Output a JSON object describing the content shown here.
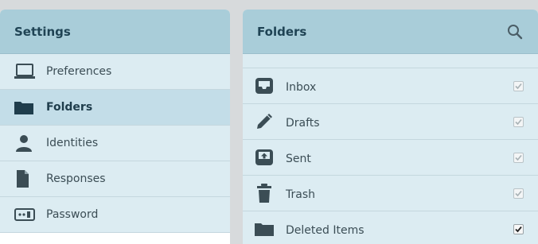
{
  "settings": {
    "title": "Settings",
    "items": [
      {
        "label": "Preferences",
        "icon": "monitor-icon"
      },
      {
        "label": "Folders",
        "icon": "folder-icon",
        "selected": true
      },
      {
        "label": "Identities",
        "icon": "user-icon"
      },
      {
        "label": "Responses",
        "icon": "document-icon"
      },
      {
        "label": "Password",
        "icon": "password-icon"
      }
    ]
  },
  "folders": {
    "title": "Folders",
    "search_icon": "search-icon",
    "items": [
      {
        "label": "Inbox",
        "icon": "inbox-icon",
        "subscribed": true,
        "locked": true
      },
      {
        "label": "Drafts",
        "icon": "pencil-icon",
        "subscribed": true,
        "locked": true
      },
      {
        "label": "Sent",
        "icon": "sent-icon",
        "subscribed": true,
        "locked": true
      },
      {
        "label": "Trash",
        "icon": "trash-icon",
        "subscribed": true,
        "locked": true
      },
      {
        "label": "Deleted Items",
        "icon": "folder-icon",
        "subscribed": true,
        "locked": false
      }
    ]
  }
}
